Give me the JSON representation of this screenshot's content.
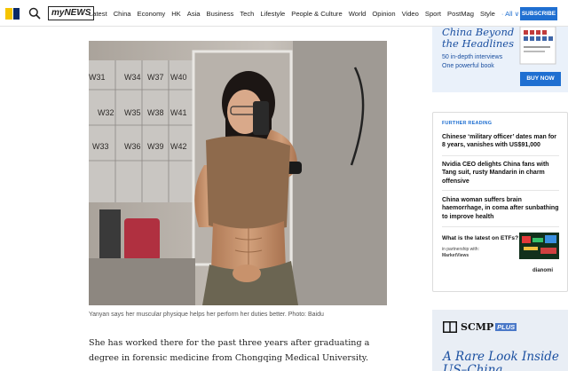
{
  "nav": {
    "mynews": "myNEWS",
    "links": [
      "Latest",
      "China",
      "Economy",
      "HK",
      "Asia",
      "Business",
      "Tech",
      "Lifestyle",
      "People & Culture",
      "World",
      "Opinion",
      "Video",
      "Sport",
      "PostMag",
      "Style"
    ],
    "all_label": "· All ∨",
    "subscribe": "SUBSCRIBE"
  },
  "article": {
    "locker_labels": [
      "W31",
      "W34",
      "W37",
      "W40",
      "W32",
      "W35",
      "W38",
      "W41",
      "W33",
      "W36",
      "W39",
      "W42"
    ],
    "caption": "Yanyan says her muscular physique helps her perform her duties better. Photo: Baidu",
    "paragraph": "She has worked there for the past three years after graduating a degree in forensic medicine from Chongqing Medical University."
  },
  "promo": {
    "title_line1": "China Beyond",
    "title_line2": "the Headlines",
    "sub_line1": "50 in-depth interviews",
    "sub_line2": "One powerful book",
    "buy_now": "BUY NOW"
  },
  "further_reading": {
    "heading": "FURTHER READING",
    "items": [
      "Chinese ‘military officer’ dates man for 8 years, vanishes with US$91,000",
      "Nvidia CEO delights China fans with Tang suit, rusty Mandarin in charm offensive",
      "China woman suffers brain haemorrhage, in coma after sunbathing to improve health"
    ],
    "etf_title": "What is the latest on ETFs?",
    "etf_partner_line1": "in partnership with:",
    "etf_partner_line2": "MarketViews",
    "etf_brand": "dianomi"
  },
  "plus": {
    "brand": "SCMP",
    "tag": "PLUS",
    "headline": "A Rare Look Inside US–China"
  },
  "colors": {
    "accent_blue": "#1f6fd1",
    "logo_yellow": "#f5c400",
    "logo_navy": "#0a2a66",
    "promo_title": "#1a4fa0"
  }
}
